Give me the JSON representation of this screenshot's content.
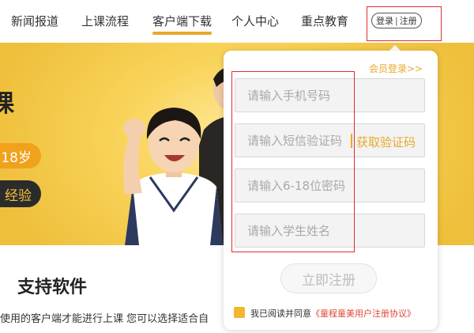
{
  "nav": {
    "items": [
      {
        "label": "新闻报道"
      },
      {
        "label": "上课流程"
      },
      {
        "label": "客户端下载",
        "active": true
      },
      {
        "label": "个人中心"
      },
      {
        "label": "重点教育"
      }
    ],
    "login": "登录",
    "register": "注册"
  },
  "banner": {
    "partial_char": "课",
    "age_pill": "18岁",
    "exp_pill": "经验"
  },
  "support": {
    "title": "支持软件",
    "text": "使用的客户端才能进行上课 您可以选择适合自"
  },
  "popup": {
    "member_login": "会员登录>>",
    "fields": {
      "phone_placeholder": "请输入手机号码",
      "sms_placeholder": "请输入短信验证码",
      "password_placeholder": "请输入6-18位密码",
      "name_placeholder": "请输入学生姓名"
    },
    "get_code": "获取验证码",
    "submit": "立即注册",
    "agree_text": "我已阅读并同意",
    "agreement_link": "《童程童美用户注册协议》"
  },
  "colors": {
    "accent": "#e8a92a",
    "highlight_box": "#e22c2c",
    "link_red": "#e0473b"
  }
}
